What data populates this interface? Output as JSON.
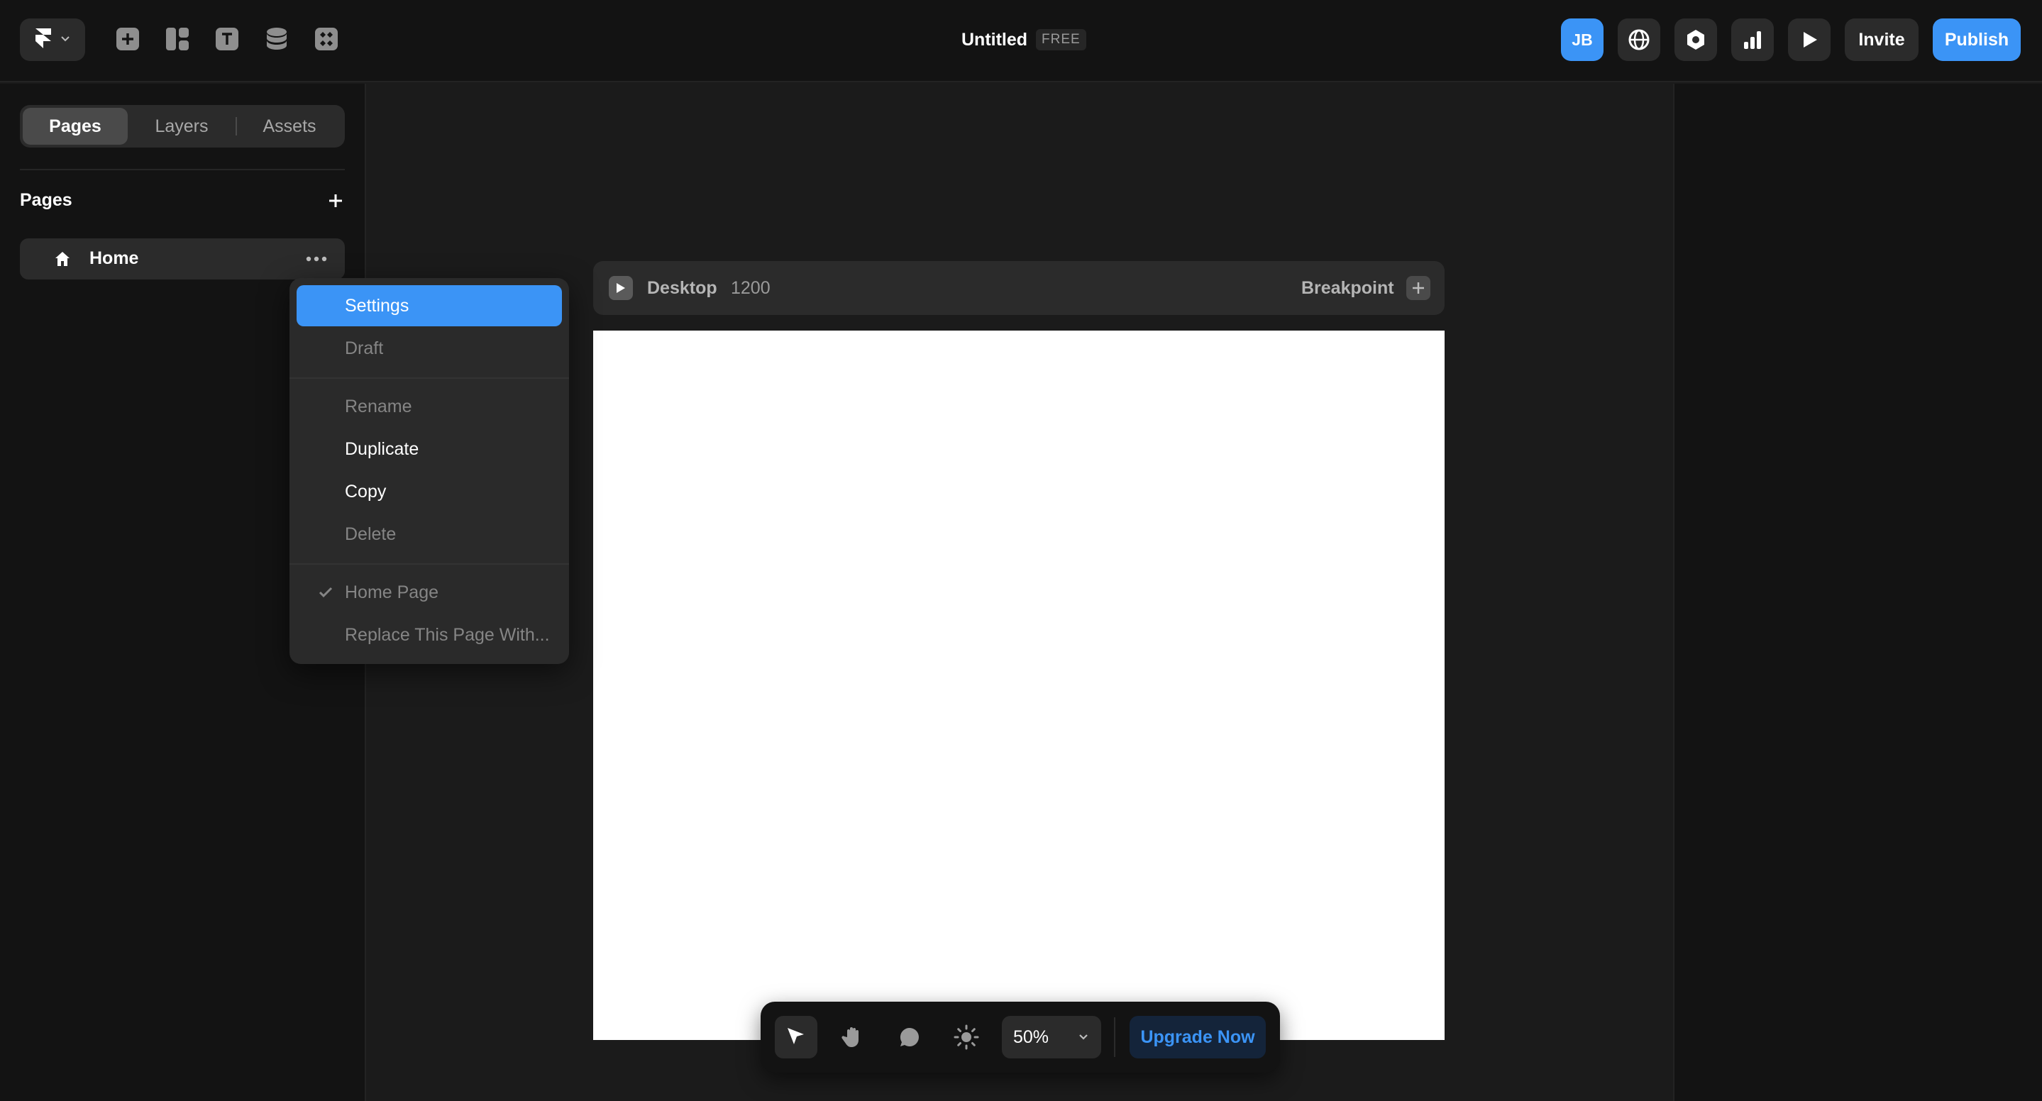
{
  "header": {
    "title": "Untitled",
    "plan_badge": "FREE",
    "avatar_initials": "JB",
    "invite_label": "Invite",
    "publish_label": "Publish",
    "tools": [
      "insert-icon",
      "layout-icon",
      "text-icon",
      "cms-icon",
      "components-icon"
    ],
    "right_icons": [
      "globe-icon",
      "settings-hexagon-icon",
      "analytics-icon",
      "preview-play-icon"
    ]
  },
  "left_panel": {
    "tabs": [
      {
        "label": "Pages",
        "active": true
      },
      {
        "label": "Layers",
        "active": false
      },
      {
        "label": "Assets",
        "active": false
      }
    ],
    "section_title": "Pages",
    "pages": [
      {
        "label": "Home",
        "icon": "home-icon"
      }
    ]
  },
  "context_menu": {
    "groups": [
      [
        {
          "label": "Settings",
          "state": "highlighted"
        },
        {
          "label": "Draft",
          "state": "disabled"
        }
      ],
      [
        {
          "label": "Rename",
          "state": "disabled"
        },
        {
          "label": "Duplicate",
          "state": "enabled"
        },
        {
          "label": "Copy",
          "state": "enabled"
        },
        {
          "label": "Delete",
          "state": "disabled"
        }
      ],
      [
        {
          "label": "Home Page",
          "state": "disabled",
          "checked": true
        },
        {
          "label": "Replace This Page With...",
          "state": "disabled"
        }
      ]
    ]
  },
  "canvas": {
    "breakpoint_name": "Desktop",
    "breakpoint_width": "1200",
    "breakpoint_label": "Breakpoint"
  },
  "bottom_toolbar": {
    "tools": [
      "select-cursor-icon",
      "hand-pan-icon",
      "comment-icon",
      "theme-sun-icon"
    ],
    "active_tool": "select-cursor-icon",
    "zoom": "50%",
    "upgrade_label": "Upgrade Now"
  },
  "colors": {
    "accent": "#3b94f6",
    "background": "#1b1b1b",
    "panel": "#131313",
    "control": "#2b2b2b"
  }
}
